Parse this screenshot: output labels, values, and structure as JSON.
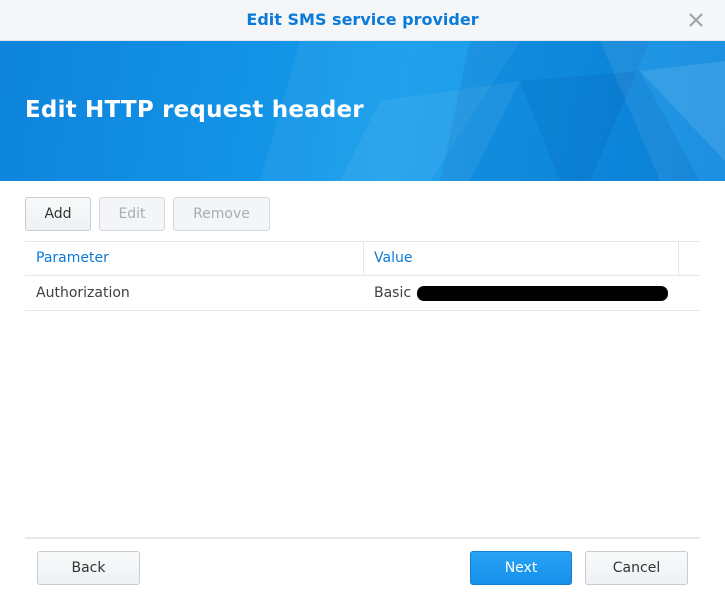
{
  "window": {
    "title": "Edit SMS service provider",
    "close_icon": "close-icon"
  },
  "banner": {
    "heading": "Edit HTTP request header"
  },
  "toolbar": {
    "add_label": "Add",
    "edit_label": "Edit",
    "remove_label": "Remove"
  },
  "table": {
    "columns": [
      "Parameter",
      "Value"
    ],
    "rows": [
      {
        "parameter": "Authorization",
        "value": "Basic"
      }
    ]
  },
  "footer": {
    "back_label": "Back",
    "next_label": "Next",
    "cancel_label": "Cancel"
  },
  "colors": {
    "accent": "#0b7ad8",
    "primary_button": "#1b95ee",
    "banner": "#0e8ee2"
  }
}
